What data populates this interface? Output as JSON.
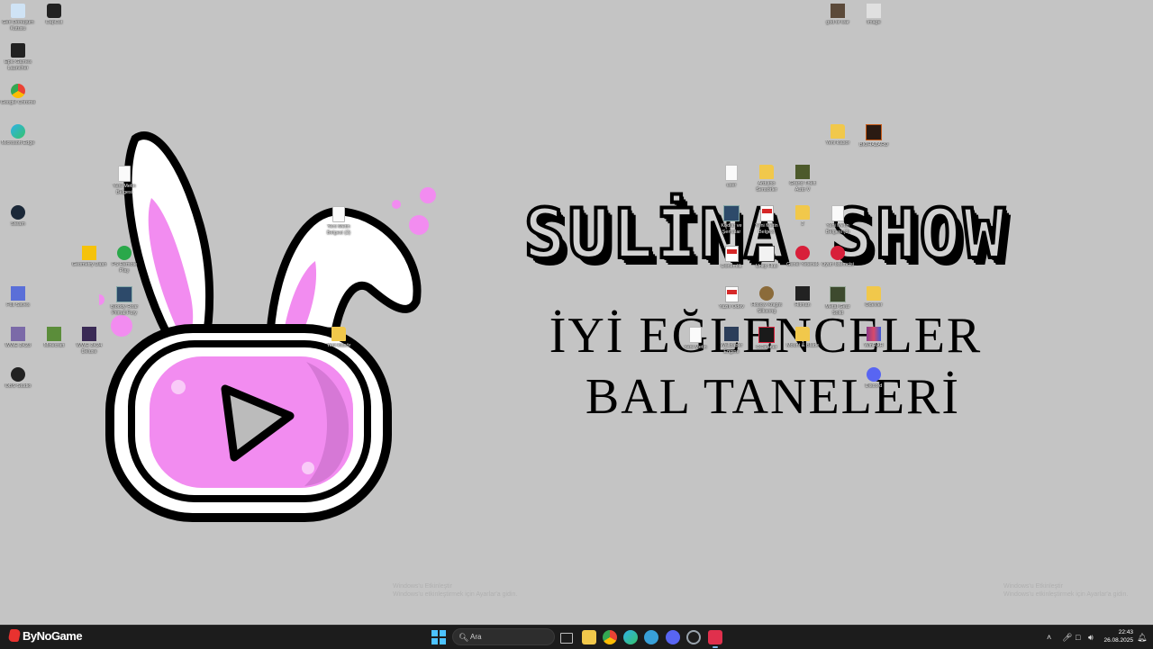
{
  "wallpaper": {
    "title": "SULİNA SHOW",
    "line1": "İYİ EĞLENCELER",
    "line2": "BAL TANELERİ",
    "watermark_left": [
      "Windows'u Etkinleştir",
      "Windows'u etkinleştirmek için Ayarlar'a gidin."
    ],
    "watermark_right": [
      "Windows'u Etkinleştir",
      "Windows'u etkinleştirmek için Ayarlar'a gidin."
    ],
    "colors": {
      "background": "#c4c4c4",
      "ear_inner": "#f28cf0",
      "screen_pink": "#f28cf0"
    }
  },
  "desktop_icons": [
    {
      "label": "Geri Dönüşüm Kutusu",
      "icon": "recycle-bin-icon"
    },
    {
      "label": "CapCut",
      "icon": "capcut-icon"
    },
    {
      "label": "Epic Games Launcher",
      "icon": "epic-games-icon"
    },
    {
      "label": "Google Chrome",
      "icon": "chrome-icon"
    },
    {
      "label": "Microsoft Edge",
      "icon": "edge-icon"
    },
    {
      "label": "Steam",
      "icon": "steam-icon"
    },
    {
      "label": "Yeni Metin Belgesi",
      "icon": "text-file-icon"
    },
    {
      "label": "Yeni Metin Belgesi (2)",
      "icon": "text-file-icon"
    },
    {
      "label": "Geometry Dash",
      "icon": "game-icon"
    },
    {
      "label": "PS Remote Play",
      "icon": "remote-play-icon"
    },
    {
      "label": "Bloody Roar Primal Fury",
      "icon": "game-icon"
    },
    {
      "label": "Full Saves",
      "icon": "app-icon"
    },
    {
      "label": "WWE 2K23",
      "icon": "game-icon"
    },
    {
      "label": "Minecraft",
      "icon": "minecraft-icon"
    },
    {
      "label": "WWE 2K24 Deluxe",
      "icon": "game-icon"
    },
    {
      "label": "Yeni klasör",
      "icon": "folder-icon"
    },
    {
      "label": "OBS Studio",
      "icon": "obs-icon"
    },
    {
      "label": "god of war",
      "icon": "game-icon"
    },
    {
      "label": "Image",
      "icon": "image-icon"
    },
    {
      "label": "Yeni klasör",
      "icon": "folder-icon"
    },
    {
      "label": "BIOHAZARD",
      "icon": "game-icon"
    },
    {
      "label": "user",
      "icon": "text-file-icon"
    },
    {
      "label": "Arduino Sensörler",
      "icon": "folder-icon"
    },
    {
      "label": "Grand Theft Auto V",
      "icon": "game-icon"
    },
    {
      "label": "Kodlar ve Şemalar",
      "icon": "pdf-icon"
    },
    {
      "label": "Yeni Metin Belgesi",
      "icon": "pdf-icon"
    },
    {
      "label": "2",
      "icon": "folder-icon"
    },
    {
      "label": "Yeni Metin Belgesi (3)",
      "icon": "text-file-icon"
    },
    {
      "label": "Dönemlik",
      "icon": "pdf-icon"
    },
    {
      "label": "Unity Hub",
      "icon": "unity-icon"
    },
    {
      "label": "Genel Yetenek",
      "icon": "office-icon"
    },
    {
      "label": "Oyun İstemcisi",
      "icon": "office-icon"
    },
    {
      "label": "Yazılı Ödev",
      "icon": "pdf-icon"
    },
    {
      "label": "Hollow Knight Silksong",
      "icon": "game-icon"
    },
    {
      "label": "Hitman",
      "icon": "game-icon"
    },
    {
      "label": "Metal Gear Solid",
      "icon": "game-icon"
    },
    {
      "label": "Ödevler",
      "icon": "folder-icon"
    },
    {
      "label": "Yeni Metin",
      "icon": "text-file-icon"
    },
    {
      "label": "Wallpaper Engine",
      "icon": "game-icon"
    },
    {
      "label": "CCleaner",
      "icon": "app-icon"
    },
    {
      "label": "Mount & Blade",
      "icon": "game-icon"
    },
    {
      "label": "WinRAR",
      "icon": "winrar-icon"
    },
    {
      "label": "Discord",
      "icon": "discord-icon"
    }
  ],
  "taskbar": {
    "search_placeholder": "Ara",
    "apps": [
      {
        "name": "task-view",
        "color": "#bdbdbd"
      },
      {
        "name": "file-explorer",
        "color": "#f1c84b"
      },
      {
        "name": "chrome",
        "color": "#e94235"
      },
      {
        "name": "edge",
        "color": "#2fb1e8"
      },
      {
        "name": "app-blue",
        "color": "#38a0d8"
      },
      {
        "name": "discord",
        "color": "#5865f2"
      },
      {
        "name": "steam-like",
        "color": "#9aa4ad"
      },
      {
        "name": "recording-app",
        "color": "#e0304d"
      }
    ],
    "clock_time": "22:43",
    "clock_date": "26.08.2025",
    "brand_overlay": "ByNoGame"
  }
}
